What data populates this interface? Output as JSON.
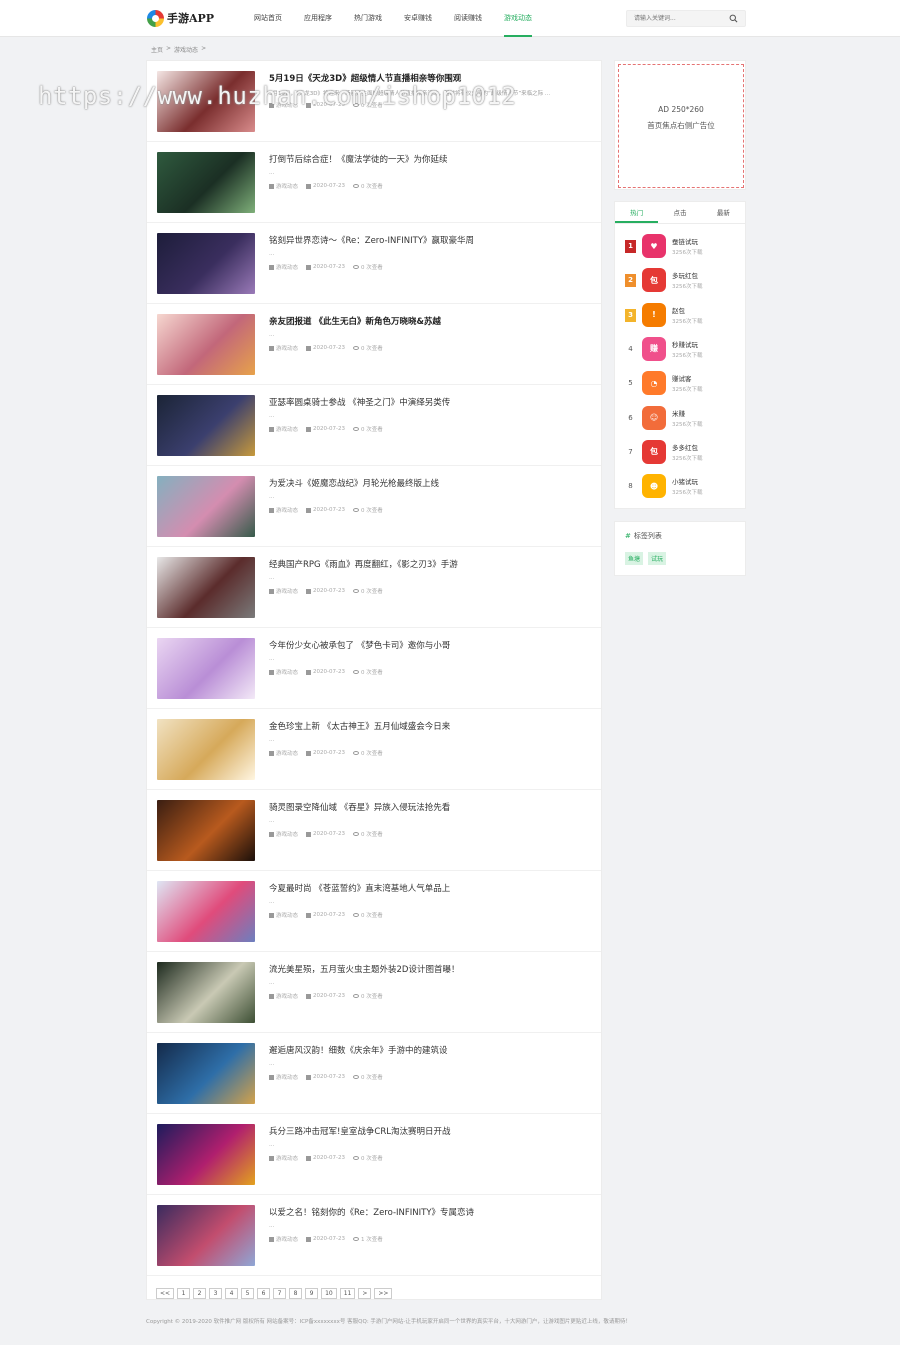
{
  "header": {
    "logo_text": "手游APP",
    "nav": [
      "网站首页",
      "应用程序",
      "热门游戏",
      "安卓赚钱",
      "阅读赚钱",
      "游戏动态"
    ],
    "active_nav": 5,
    "search_placeholder": "请输入关键词..."
  },
  "breadcrumb": [
    "主页",
    ">",
    "游戏动态",
    ">"
  ],
  "articles": [
    {
      "title": "5月19日《天龙3D》超级情人节直播相亲等你围观",
      "desc": "5月19日，《天龙3D》将迎来一场别开生面的超级情人节直播相亲活动，届时将有仪式感的“超级情人节”来临之际 ...",
      "category": "游戏动态",
      "date": "2020-07-23",
      "views": "0 次查看",
      "bold": true,
      "thumb": [
        "#f4e6e4",
        "#7a2e2e",
        "#d98c8c"
      ]
    },
    {
      "title": "打倒节后综合症！《魔法学徒的一天》为你延续",
      "desc": "...",
      "category": "游戏动态",
      "date": "2020-07-23",
      "views": "0 次查看",
      "bold": false,
      "thumb": [
        "#2f5a3e",
        "#1b2f24",
        "#7fb07a"
      ]
    },
    {
      "title": "铭刻异世界恋诗～《Re：Zero-INFINITY》赢取豪华周",
      "desc": "...",
      "category": "游戏动态",
      "date": "2020-07-23",
      "views": "0 次查看",
      "bold": false,
      "thumb": [
        "#1d1d3a",
        "#3a2e5e",
        "#9a7ab8"
      ]
    },
    {
      "title": "亲友团报道 《此生无白》新角色万晓晓&苏越",
      "desc": "...",
      "category": "游戏动态",
      "date": "2020-07-23",
      "views": "0 次查看",
      "bold": true,
      "thumb": [
        "#f6d7d0",
        "#c2677a",
        "#e7a24a"
      ]
    },
    {
      "title": "亚瑟率圆桌骑士参战 《神圣之门》中演绎另类传",
      "desc": "...",
      "category": "游戏动态",
      "date": "2020-07-23",
      "views": "0 次查看",
      "bold": false,
      "thumb": [
        "#1b2436",
        "#3b3f6e",
        "#c79a3c"
      ]
    },
    {
      "title": "为爱决斗《姬魔恋战纪》月轮光枪最终版上线",
      "desc": "...",
      "category": "游戏动态",
      "date": "2020-07-23",
      "views": "0 次查看",
      "bold": false,
      "thumb": [
        "#84b0bf",
        "#d48db0",
        "#365b4a"
      ]
    },
    {
      "title": "经典国产RPG《雨血》再度翻红，《影之刃3》手游",
      "desc": "...",
      "category": "游戏动态",
      "date": "2020-07-23",
      "views": "0 次查看",
      "bold": false,
      "thumb": [
        "#e8e8e8",
        "#5b2c2c",
        "#7a7a7a"
      ]
    },
    {
      "title": "今年份少女心被承包了 《梦色卡司》邀你与小哥",
      "desc": "...",
      "category": "游戏动态",
      "date": "2020-07-23",
      "views": "0 次查看",
      "bold": false,
      "thumb": [
        "#ead6f2",
        "#b98ed6",
        "#f3e9f7"
      ]
    },
    {
      "title": "金色珍宝上新 《太古神王》五月仙域盛会今日来",
      "desc": "...",
      "category": "游戏动态",
      "date": "2020-07-23",
      "views": "0 次查看",
      "bold": false,
      "thumb": [
        "#f1e2c2",
        "#d6a95a",
        "#fff6e2"
      ]
    },
    {
      "title": "骑灵图录空降仙域 《吞星》异族入侵玩法抢先看",
      "desc": "...",
      "category": "游戏动态",
      "date": "2020-07-23",
      "views": "0 次查看",
      "bold": false,
      "thumb": [
        "#3a1e12",
        "#b85a1e",
        "#1b0f0a"
      ]
    },
    {
      "title": "今夏最时尚 《苍蓝誓约》直末湾基地人气单品上",
      "desc": "...",
      "category": "游戏动态",
      "date": "2020-07-23",
      "views": "0 次查看",
      "bold": false,
      "thumb": [
        "#dfe6f4",
        "#e04b7b",
        "#6c7fbf"
      ]
    },
    {
      "title": "流光美星殒，五月萤火虫主题外装2D设计图首曝！",
      "desc": "...",
      "category": "游戏动态",
      "date": "2020-07-23",
      "views": "0 次查看",
      "bold": false,
      "thumb": [
        "#1d2a1e",
        "#c9c9b4",
        "#3d4f34"
      ]
    },
    {
      "title": "邂逅唐风汉韵！细数《庆余年》手游中的建筑设",
      "desc": "...",
      "category": "游戏动态",
      "date": "2020-07-23",
      "views": "0 次查看",
      "bold": false,
      "thumb": [
        "#142a4a",
        "#2e6ea8",
        "#d4a24a"
      ]
    },
    {
      "title": "兵分三路冲击冠军!皇室战争CRL淘汰赛明日开战",
      "desc": "...",
      "category": "游戏动态",
      "date": "2020-07-23",
      "views": "0 次查看",
      "bold": false,
      "thumb": [
        "#1d1c5c",
        "#b01f6e",
        "#e3a21e"
      ]
    },
    {
      "title": "以爱之名！铭刻你的《Re：Zero-INFINITY》专属恋诗",
      "desc": "...",
      "category": "游戏动态",
      "date": "2020-07-23",
      "views": "1 次查看",
      "bold": false,
      "thumb": [
        "#3a2b5e",
        "#c24d6e",
        "#8fa7d6"
      ]
    }
  ],
  "pagination": [
    "<<",
    "1",
    "2",
    "3",
    "4",
    "5",
    "6",
    "7",
    "8",
    "9",
    "10",
    "11",
    ">",
    ">>"
  ],
  "ad": {
    "line1": "AD 250*260",
    "line2": "首页焦点右侧广告位"
  },
  "rank": {
    "tabs": [
      "热门",
      "点击",
      "最新"
    ],
    "active_tab": 0,
    "items": [
      {
        "num": "1",
        "name": "蚕链试玩",
        "count": "3256次下载",
        "color": "#e8336b",
        "glyph": "♥",
        "badge": "#c62828"
      },
      {
        "num": "2",
        "name": "多玩红包",
        "count": "3256次下载",
        "color": "#e53935",
        "glyph": "包",
        "badge": "#ef8f2c"
      },
      {
        "num": "3",
        "name": "赵包",
        "count": "3256次下载",
        "color": "#f57c00",
        "glyph": "!",
        "badge": "#f3b42b"
      },
      {
        "num": "4",
        "name": "秒赚试玩",
        "count": "3256次下载",
        "color": "#f0508b",
        "glyph": "赚",
        "badge": ""
      },
      {
        "num": "5",
        "name": "赚试客",
        "count": "3256次下载",
        "color": "#ff7a2a",
        "glyph": "◔",
        "badge": ""
      },
      {
        "num": "6",
        "name": "米赚",
        "count": "3256次下载",
        "color": "#f26c3a",
        "glyph": "☺",
        "badge": ""
      },
      {
        "num": "7",
        "name": "多多红包",
        "count": "3256次下载",
        "color": "#e53935",
        "glyph": "包",
        "badge": ""
      },
      {
        "num": "8",
        "name": "小猪试玩",
        "count": "3256次下载",
        "color": "#ffb300",
        "glyph": "☻",
        "badge": ""
      }
    ]
  },
  "tags": {
    "title": "标签列表",
    "items": [
      "鱼塘",
      "试玩"
    ]
  },
  "footer": "Copyright © 2019-2020 软件推广网 版权所有 网站备案号：ICP备xxxxxxxx号   客服QQ: 手游门户网站-让手机玩家开启同一个世界的真实平台，十大网游门户，让游戏图片更贴近上线，敬请期待！",
  "watermark": "https://www.huzhan.com/ishop1012"
}
